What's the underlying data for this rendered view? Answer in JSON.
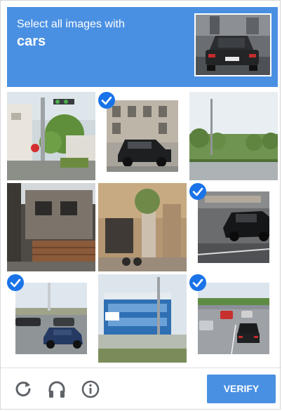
{
  "challenge": {
    "instruction": "Select all images with",
    "target": "cars"
  },
  "tiles": [
    {
      "label": "tile-1",
      "selected": false
    },
    {
      "label": "tile-2",
      "selected": true
    },
    {
      "label": "tile-3",
      "selected": false
    },
    {
      "label": "tile-4",
      "selected": false
    },
    {
      "label": "tile-5",
      "selected": false
    },
    {
      "label": "tile-6",
      "selected": true
    },
    {
      "label": "tile-7",
      "selected": true
    },
    {
      "label": "tile-8",
      "selected": false
    },
    {
      "label": "tile-9",
      "selected": true
    }
  ],
  "footer": {
    "verify_label": "VERIFY",
    "icons": [
      "refresh-icon",
      "audio-headphones-icon",
      "info-icon"
    ]
  },
  "colors": {
    "accent": "#4a90e2",
    "check": "#1a73e8"
  }
}
